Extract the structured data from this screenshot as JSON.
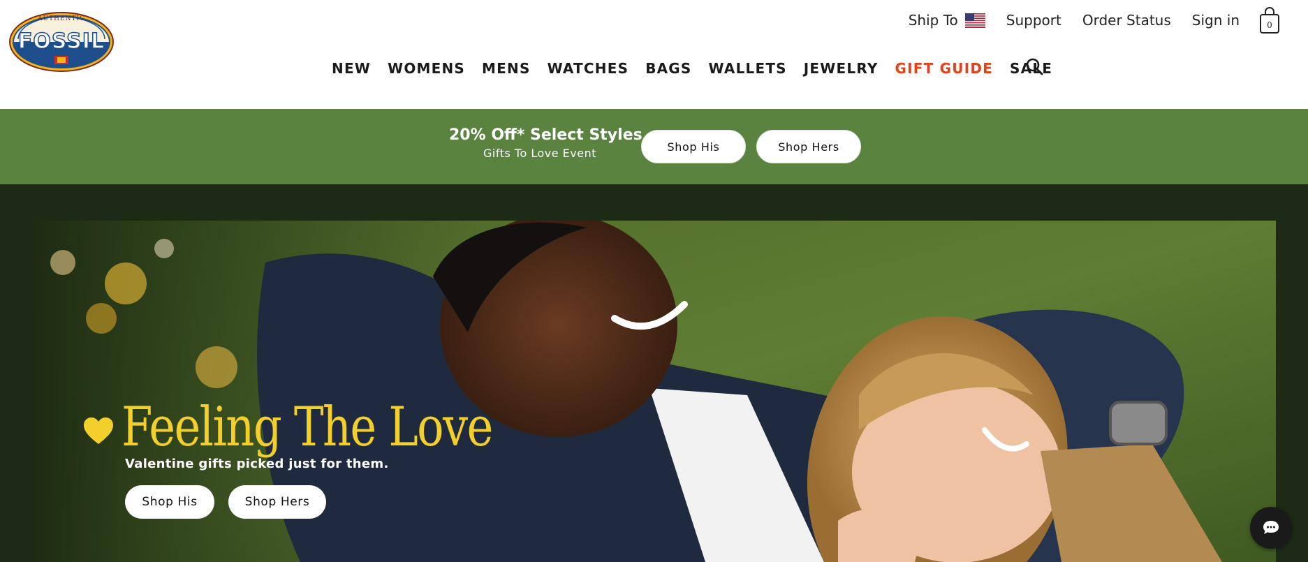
{
  "brand": {
    "logo_top_text": "AUTHENTIC",
    "logo_name": "FOSSIL"
  },
  "utility_nav": {
    "ship_to": "Ship To",
    "support": "Support",
    "order_status": "Order Status",
    "sign_in": "Sign in",
    "bag_count": "0"
  },
  "main_nav": {
    "items": [
      {
        "label": "NEW"
      },
      {
        "label": "WOMENS"
      },
      {
        "label": "MENS"
      },
      {
        "label": "WATCHES"
      },
      {
        "label": "BAGS"
      },
      {
        "label": "WALLETS"
      },
      {
        "label": "JEWELRY"
      },
      {
        "label": "GIFT GUIDE"
      },
      {
        "label": "SALE"
      }
    ]
  },
  "promo": {
    "title": "20% Off* Select Styles",
    "subtitle": "Gifts To Love Event",
    "shop_his": "Shop His",
    "shop_hers": "Shop Hers"
  },
  "hero": {
    "title": "Feeling The Love",
    "subtitle": "Valentine gifts picked just for them.",
    "shop_his": "Shop His",
    "shop_hers": "Shop Hers"
  },
  "colors": {
    "promo_bg": "#5a8340",
    "accent_nav": "#e0431b",
    "hero_title": "#f3cf2b"
  },
  "icons": [
    "us-flag-icon",
    "shopping-bag-icon",
    "search-icon",
    "heart-icon",
    "chat-icon"
  ]
}
